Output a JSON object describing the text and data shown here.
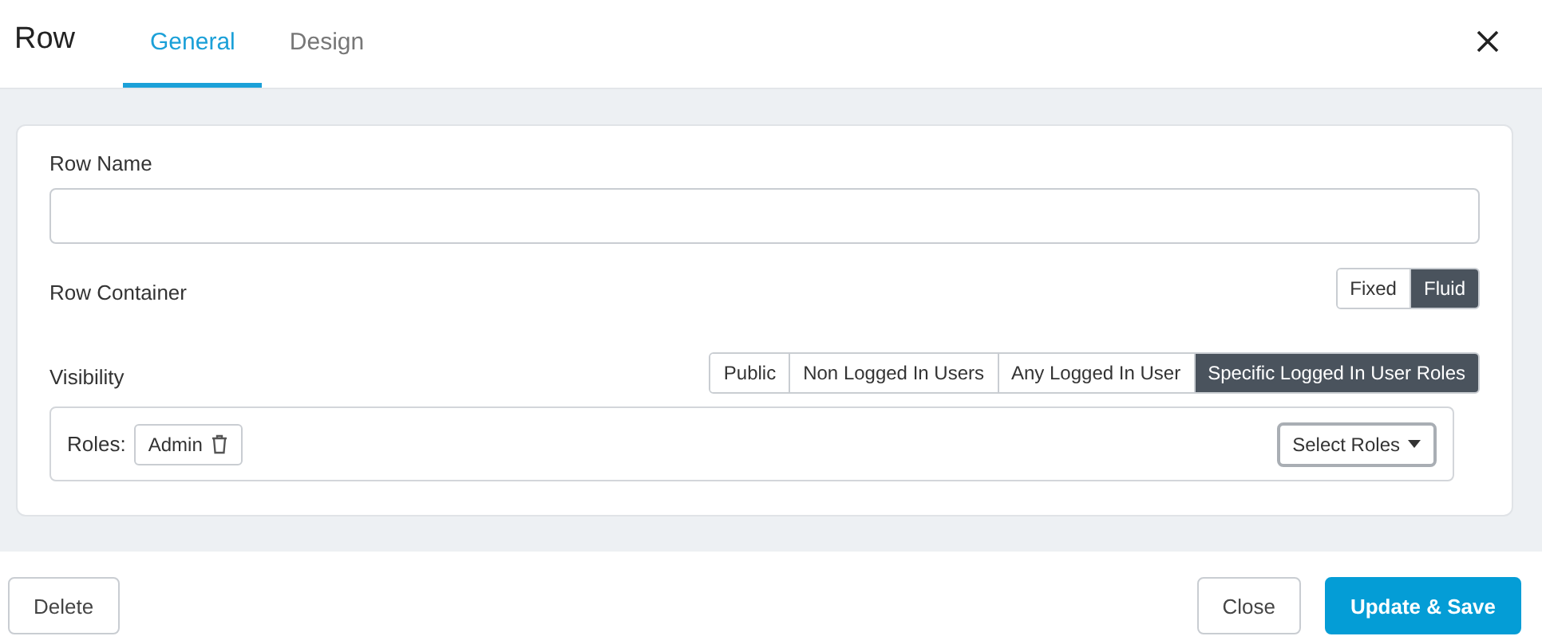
{
  "window": {
    "title": "Row"
  },
  "tabs": [
    {
      "label": "General",
      "selected": true
    },
    {
      "label": "Design",
      "selected": false
    }
  ],
  "row_name": {
    "label": "Row Name"
  },
  "row_container": {
    "label": "Row Container",
    "options": [
      {
        "label": "Fixed",
        "selected": false
      },
      {
        "label": "Fluid",
        "selected": true
      }
    ]
  },
  "visibility": {
    "label": "Visibility",
    "options": [
      {
        "label": "Public",
        "selected": false
      },
      {
        "label": "Non Logged In Users",
        "selected": false
      },
      {
        "label": "Any Logged In User",
        "selected": false
      },
      {
        "label": "Specific Logged In User Roles",
        "selected": true
      }
    ]
  },
  "roles": {
    "label": "Roles:",
    "items": [
      "Admin"
    ],
    "select_button": "Select Roles"
  },
  "footer": {
    "delete": "Delete",
    "close": "Close",
    "save": "Update & Save"
  }
}
